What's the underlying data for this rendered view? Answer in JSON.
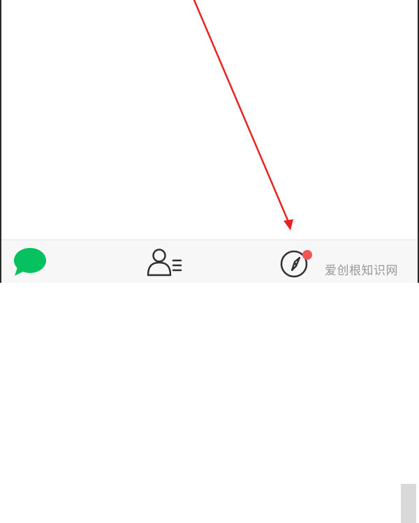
{
  "annotation": {
    "arrow_icon": "red-arrow-pointing-to-discover-tab",
    "color": "#e8231f"
  },
  "tab_bar": {
    "tabs": [
      {
        "icon": "chat-bubble-icon",
        "active": true,
        "color": "#07c160"
      },
      {
        "icon": "contacts-icon",
        "active": false,
        "color": "#303030"
      },
      {
        "icon": "compass-icon",
        "active": false,
        "color": "#303030",
        "has_badge": true
      }
    ],
    "badge_color": "#f35454"
  },
  "watermark": {
    "text": "爱创根知识网"
  }
}
